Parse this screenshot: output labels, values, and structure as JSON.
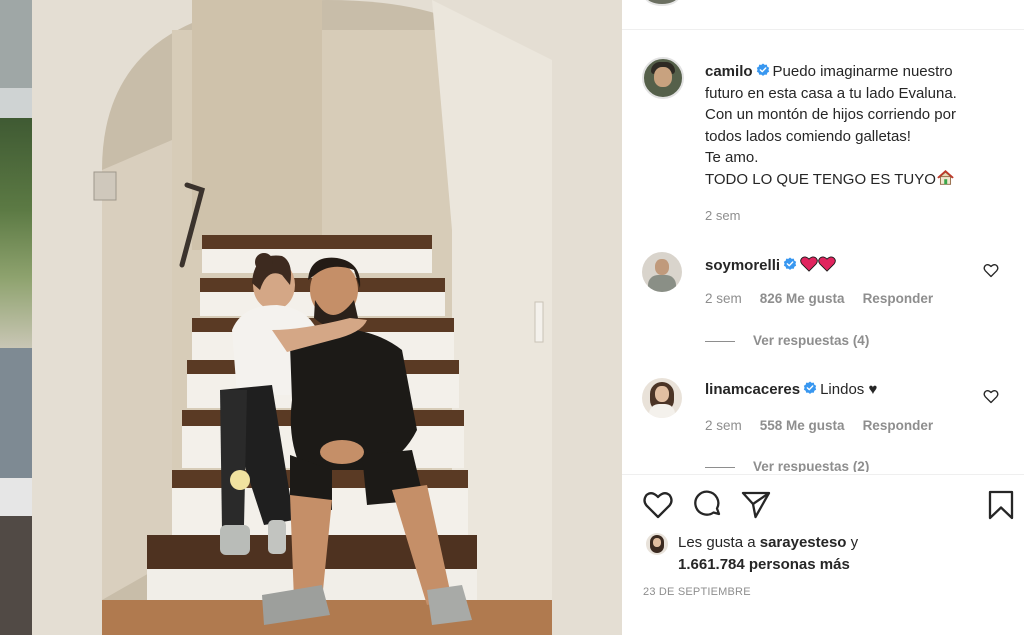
{
  "post": {
    "author": "camilo",
    "caption_lines": [
      "Puedo imaginarme nuestro",
      "futuro en esta casa a tu lado Evaluna.",
      "Con un montón de hijos corriendo por",
      "todos lados comiendo galletas!",
      "Te amo.",
      "TODO LO QUE TENGO ES TUYO"
    ],
    "caption_emoji": "house-emoji",
    "time": "2 sem",
    "date": "23 DE SEPTIEMBRE"
  },
  "comments": [
    {
      "username": "soymorelli",
      "text": "",
      "emoji": "red-hearts-emoji",
      "time": "2 sem",
      "likes": "826 Me gusta",
      "reply": "Responder",
      "view_replies": "Ver respuestas (4)"
    },
    {
      "username": "linamcaceres",
      "text": "Lindos ♥",
      "time": "2 sem",
      "likes": "558 Me gusta",
      "reply": "Responder",
      "view_replies": "Ver respuestas (2)"
    }
  ],
  "likes": {
    "prefix": "Les gusta a",
    "first_user": "sarayesteso",
    "connector": "y",
    "others": "1.661.784 personas más"
  },
  "icons": {
    "like": "heart-outline-icon",
    "comment": "comment-bubble-icon",
    "share": "paper-plane-icon",
    "save": "bookmark-icon",
    "verified": "verified-badge-icon"
  },
  "colors": {
    "verified": "#3897f0",
    "text": "#262626",
    "muted": "#8e8e8e",
    "heart_red": "#e0245e"
  }
}
